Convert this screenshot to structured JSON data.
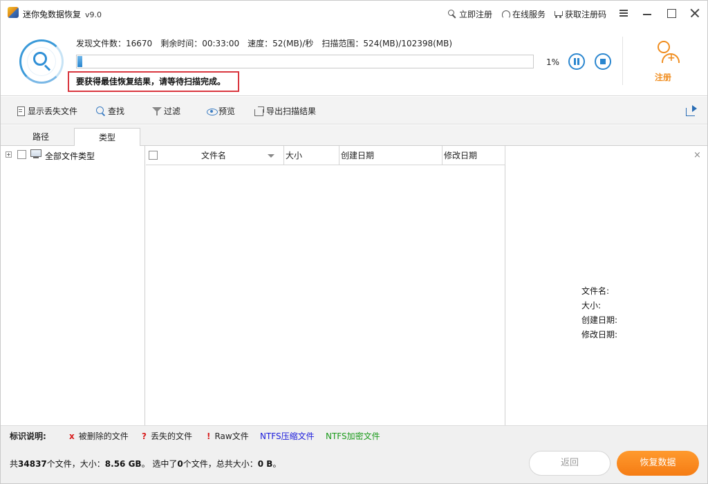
{
  "titlebar": {
    "title": "迷你兔数据恢复",
    "version": "v9.0",
    "links": {
      "register": "立即注册",
      "online_service": "在线服务",
      "get_code": "获取注册码"
    }
  },
  "scan": {
    "found_label": "发现文件数：",
    "found_value": "16670",
    "remaining_label": "剩余时间：",
    "remaining_value": "00:33:00",
    "speed_label": "速度：",
    "speed_value": "52(MB)/秒",
    "range_label": "扫描范围：",
    "range_value": "524(MB)/102398(MB)",
    "progress_percent": 1,
    "progress_text": "1%",
    "notice": "要获得最佳恢复结果，请等待扫描完成。",
    "register_label": "注册"
  },
  "toolbar": {
    "show_lost": "显示丢失文件",
    "find": "查找",
    "filter": "过滤",
    "preview": "预览",
    "export": "导出扫描结果"
  },
  "tabs": {
    "path": "路径",
    "type": "类型"
  },
  "tree": {
    "all_types": "全部文件类型"
  },
  "table": {
    "columns": {
      "name": "文件名",
      "size": "大小",
      "created": "创建日期",
      "modified": "修改日期"
    }
  },
  "preview": {
    "close": "×",
    "name_label": "文件名:",
    "size_label": "大小:",
    "created_label": "创建日期:",
    "modified_label": "修改日期:"
  },
  "legend": {
    "title": "标识说明:",
    "deleted_mark": "x",
    "deleted": "被删除的文件",
    "lost_mark": "?",
    "lost": "丢失的文件",
    "raw_mark": "!",
    "raw": "Raw文件",
    "ntfs_compressed": "NTFS压缩文件",
    "ntfs_encrypted": "NTFS加密文件",
    "colors": {
      "mark": "#d81e1e",
      "compressed": "#1a1adb",
      "encrypted": "#1a9a1a"
    }
  },
  "status": {
    "total_prefix": "共",
    "total_files": "34837",
    "total_mid": "个文件，大小：",
    "total_size": "8.56 GB",
    "sel_prefix": "。  选中了",
    "selected": "0",
    "sel_mid": "个文件，总共大小：",
    "selected_size": "0 B",
    "sel_suffix": "。",
    "back": "返回",
    "recover": "恢复数据"
  }
}
